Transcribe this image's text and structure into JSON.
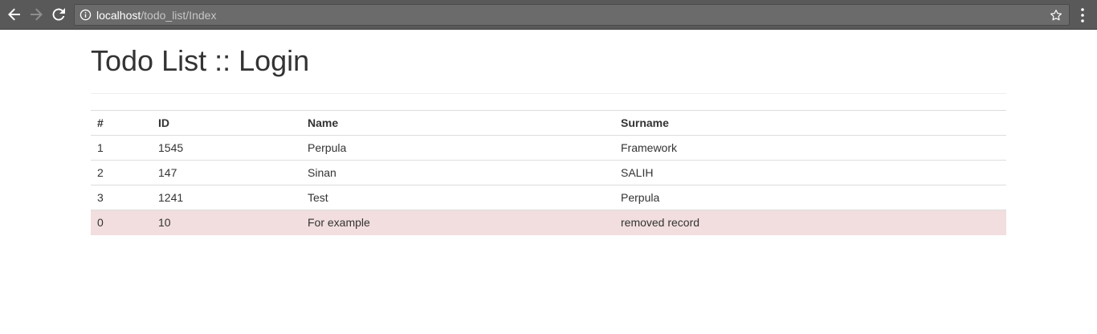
{
  "browser": {
    "url_host": "localhost",
    "url_path": "/todo_list/Index",
    "icons": {
      "back": "arrow-left-icon",
      "forward": "arrow-right-icon",
      "reload": "reload-icon",
      "info": "info-icon",
      "bookmark": "star-icon",
      "menu": "kebab-menu-icon"
    }
  },
  "page": {
    "title": "Todo List :: Login"
  },
  "table": {
    "headers": [
      "#",
      "ID",
      "Name",
      "Surname"
    ],
    "rows": [
      {
        "num": "1",
        "id": "1545",
        "name": "Perpula",
        "surname": "Framework",
        "highlight": false
      },
      {
        "num": "2",
        "id": "147",
        "name": "Sinan",
        "surname": "SALIH",
        "highlight": false
      },
      {
        "num": "3",
        "id": "1241",
        "name": "Test",
        "surname": "Perpula",
        "highlight": false
      },
      {
        "num": "0",
        "id": "10",
        "name": "For example",
        "surname": "removed record",
        "highlight": true
      }
    ]
  },
  "colors": {
    "chrome_bg": "#595959",
    "omnibox_bg": "#6b6b6b",
    "danger_row_bg": "#f2dede",
    "text": "#333333"
  }
}
